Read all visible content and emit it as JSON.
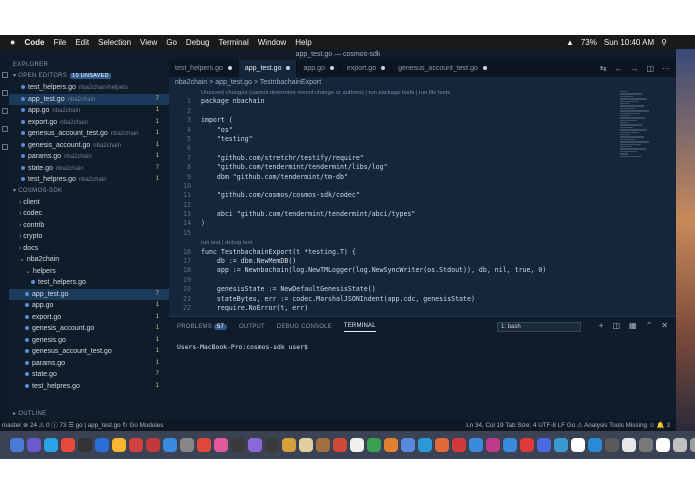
{
  "menubar": {
    "apple": "",
    "app": "Code",
    "items": [
      "File",
      "Edit",
      "Selection",
      "View",
      "Go",
      "Debug",
      "Terminal",
      "Window",
      "Help"
    ],
    "battery": "73%",
    "clock": "Sun 10:40 AM"
  },
  "window_title": "app_test.go — cosmos-sdk",
  "sidebar": {
    "explorer_label": "EXPLORER",
    "open_editors_label": "OPEN EDITORS",
    "unsaved_badge": "10 UNSAVED",
    "open_editors": [
      {
        "name": "test_helpers.go",
        "dir": "nba2chain/helpers",
        "count": ""
      },
      {
        "name": "app_test.go",
        "dir": "nba2chain",
        "count": "7"
      },
      {
        "name": "app.go",
        "dir": "nba2chain",
        "count": "1"
      },
      {
        "name": "export.go",
        "dir": "nba2chain",
        "count": "1"
      },
      {
        "name": "genesus_account_test.go",
        "dir": "nba2chain",
        "count": "1"
      },
      {
        "name": "genesis_account.go",
        "dir": "nba2chain",
        "count": "1"
      },
      {
        "name": "params.go",
        "dir": "nba2chain",
        "count": "1"
      },
      {
        "name": "state.go",
        "dir": "nba2chain",
        "count": "7"
      },
      {
        "name": "test_helpres.go",
        "dir": "nba2chain",
        "count": "1"
      }
    ],
    "project_label": "COSMOS-SDK",
    "tree": [
      {
        "name": "client",
        "count": "",
        "indent": 1
      },
      {
        "name": "codec",
        "count": "",
        "indent": 1
      },
      {
        "name": "contrib",
        "count": "",
        "indent": 1
      },
      {
        "name": "crypto",
        "count": "",
        "indent": 1
      },
      {
        "name": "docs",
        "count": "",
        "indent": 1
      },
      {
        "name": "nba2chain",
        "count": "",
        "indent": 1
      },
      {
        "name": "helpers",
        "count": "",
        "indent": 2
      },
      {
        "name": "test_helpers.go",
        "count": "",
        "indent": 3
      },
      {
        "name": "app_test.go",
        "count": "7",
        "indent": 2
      },
      {
        "name": "app.go",
        "count": "1",
        "indent": 2
      },
      {
        "name": "export.go",
        "count": "1",
        "indent": 2
      },
      {
        "name": "genesis_account.go",
        "count": "1",
        "indent": 2
      },
      {
        "name": "genesis.go",
        "count": "1",
        "indent": 2
      },
      {
        "name": "genesus_account_test.go",
        "count": "1",
        "indent": 2
      },
      {
        "name": "params.go",
        "count": "1",
        "indent": 2
      },
      {
        "name": "state.go",
        "count": "7",
        "indent": 2
      },
      {
        "name": "test_helpres.go",
        "count": "1",
        "indent": 2
      }
    ],
    "outline_label": "OUTLINE"
  },
  "tabs": [
    {
      "label": "test_helpers.go",
      "active": false
    },
    {
      "label": "app_test.go",
      "active": true
    },
    {
      "label": "app.go",
      "active": false
    },
    {
      "label": "export.go",
      "active": false
    },
    {
      "label": "genesus_account_test.go",
      "active": false
    }
  ],
  "breadcrumb": "nba2chain  >  app_test.go  >  TestnbachainExport",
  "code": [
    {
      "no": "",
      "t": "Unsaved changes (cannot determine recent change or authors) | run package tests | run file tests",
      "lens": true
    },
    {
      "no": "1",
      "t": "package nbachain"
    },
    {
      "no": "2",
      "t": ""
    },
    {
      "no": "3",
      "t": "import ("
    },
    {
      "no": "4",
      "t": "    \"os\""
    },
    {
      "no": "5",
      "t": "    \"testing\""
    },
    {
      "no": "6",
      "t": ""
    },
    {
      "no": "7",
      "t": "    \"github.com/stretchr/testify/require\""
    },
    {
      "no": "8",
      "t": "    \"github.com/tendermint/tendermint/libs/log\""
    },
    {
      "no": "9",
      "t": "    dbm \"github.com/tendermint/tm-db\""
    },
    {
      "no": "10",
      "t": ""
    },
    {
      "no": "11",
      "t": "    \"github.com/cosmos/cosmos-sdk/codec\""
    },
    {
      "no": "12",
      "t": ""
    },
    {
      "no": "13",
      "t": "    abci \"github.com/tendermint/tendermint/abci/types\""
    },
    {
      "no": "14",
      "t": ")"
    },
    {
      "no": "15",
      "t": ""
    },
    {
      "no": "",
      "t": "run test | debug test",
      "lens": true
    },
    {
      "no": "16",
      "t": "func TestnbachainExport(t *testing.T) {"
    },
    {
      "no": "17",
      "t": "    db := dbm.NewMemDB()"
    },
    {
      "no": "18",
      "t": "    app := Newnbachain(log.NewTMLogger(log.NewSyncWriter(os.Stdout)), db, nil, true, 0)"
    },
    {
      "no": "19",
      "t": ""
    },
    {
      "no": "20",
      "t": "    genesisState := NewDefaultGenesisState()"
    },
    {
      "no": "21",
      "t": "    stateBytes, err := codec.MarshalJSONIndent(app.cdc, genesisState)"
    },
    {
      "no": "22",
      "t": "    require.NoError(t, err)"
    }
  ],
  "panel": {
    "tabs": [
      "PROBLEMS",
      "OUTPUT",
      "DEBUG CONSOLE",
      "TERMINAL"
    ],
    "problems_count": "57",
    "shell": "1: bash",
    "prompt": "Users-MacBook-Pro:cosmos-sdk user$"
  },
  "status": {
    "left": "master   ⊗ 24 ⚠ 0 ⓘ 73   ☰ go | app_test.go   ↻ Go Modules",
    "right": "Ln 34, Col 19   Tab Size: 4   UTF-8   LF   Go   ⚠ Analysis Tools Missing   ☺   🔔 3"
  },
  "dock_colors": [
    "#4a7bd8",
    "#6a5acd",
    "#2aa3e8",
    "#e84a3a",
    "#333",
    "#2a6fd8",
    "#f5b82e",
    "#d04040",
    "#c03a3a",
    "#3a8ae0",
    "#888",
    "#e0483a",
    "#e05a9a",
    "#3a3a3a",
    "#8a6ad8",
    "#3a3a3a",
    "#d8a03a",
    "#e0d0a0",
    "#a07040",
    "#d04a3a",
    "#f0f0f0",
    "#3aa050",
    "#e08030",
    "#5a8ae0",
    "#2a9ad8",
    "#e06a3a",
    "#d03a3a",
    "#3a8ae0",
    "#c03a8a",
    "#3a8ae0",
    "#e03a3a",
    "#4a6ae0",
    "#3a9ad0",
    "#ffffff",
    "#2a8ad8",
    "#5a5a5a",
    "#e8e8e8",
    "#7a7a7a",
    "#ffffff",
    "#c0c0c0",
    "#a0a0a0"
  ]
}
